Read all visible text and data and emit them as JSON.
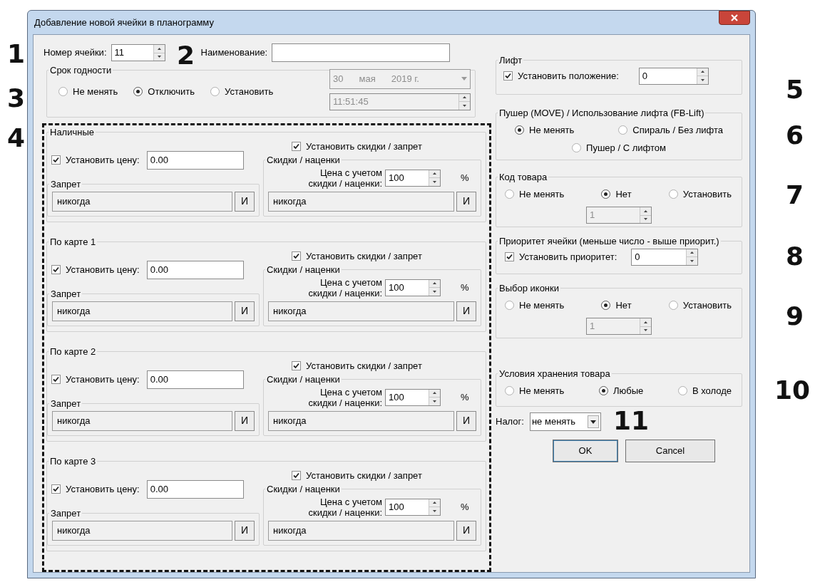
{
  "window": {
    "title": "Добавление новой ячейки в планограмму"
  },
  "cell_number": {
    "label": "Номер ячейки:",
    "value": "11"
  },
  "name_field": {
    "label": "Наименование:"
  },
  "expiry": {
    "title": "Срок годности",
    "options": [
      {
        "label": "Не менять",
        "selected": false
      },
      {
        "label": "Отключить",
        "selected": true
      },
      {
        "label": "Установить",
        "selected": false
      }
    ],
    "date": {
      "day": "30",
      "month": "мая",
      "year": "2019 г.",
      "disabled": true
    },
    "time": {
      "value": "11:51:45",
      "disabled": true
    }
  },
  "price_groups": [
    {
      "title": "Наличные",
      "set_price": {
        "label": "Установить цену:",
        "checked": true,
        "value": "0.00"
      },
      "set_discount": {
        "label": "Установить скидки / запрет",
        "checked": true
      },
      "ban": {
        "title": "Запрет",
        "value": "никогда",
        "button": "И"
      },
      "discounts": {
        "title": "Скидки / наценки",
        "price_label": [
          "Цена с учетом",
          "скидки / наценки:"
        ],
        "value": "100",
        "unit": "%",
        "schedule": "никогда",
        "button": "И"
      }
    },
    {
      "title": "По карте 1",
      "set_price": {
        "label": "Установить цену:",
        "checked": true,
        "value": "0.00"
      },
      "set_discount": {
        "label": "Установить скидки / запрет",
        "checked": true
      },
      "ban": {
        "title": "Запрет",
        "value": "никогда",
        "button": "И"
      },
      "discounts": {
        "title": "Скидки / наценки",
        "price_label": [
          "Цена с учетом",
          "скидки / наценки:"
        ],
        "value": "100",
        "unit": "%",
        "schedule": "никогда",
        "button": "И"
      }
    },
    {
      "title": "По карте 2",
      "set_price": {
        "label": "Установить цену:",
        "checked": true,
        "value": "0.00"
      },
      "set_discount": {
        "label": "Установить скидки / запрет",
        "checked": true
      },
      "ban": {
        "title": "Запрет",
        "value": "никогда",
        "button": "И"
      },
      "discounts": {
        "title": "Скидки / наценки",
        "price_label": [
          "Цена с учетом",
          "скидки / наценки:"
        ],
        "value": "100",
        "unit": "%",
        "schedule": "никогда",
        "button": "И"
      }
    },
    {
      "title": "По карте 3",
      "set_price": {
        "label": "Установить цену:",
        "checked": true,
        "value": "0.00"
      },
      "set_discount": {
        "label": "Установить скидки / запрет",
        "checked": true
      },
      "ban": {
        "title": "Запрет",
        "value": "никогда",
        "button": "И"
      },
      "discounts": {
        "title": "Скидки / наценки",
        "price_label": [
          "Цена с учетом",
          "скидки / наценки:"
        ],
        "value": "100",
        "unit": "%",
        "schedule": "никогда",
        "button": "И"
      }
    }
  ],
  "lift": {
    "title": "Лифт",
    "checkbox": {
      "label": "Установить положение:",
      "checked": true
    },
    "value": "0"
  },
  "pusher": {
    "title": "Пушер (MOVE) / Использование лифта (FB-Lift)",
    "options": [
      {
        "label": "Не менять",
        "selected": true
      },
      {
        "label": "Спираль / Без лифта",
        "selected": false
      },
      {
        "label": "Пушер / С лифтом",
        "selected": false
      }
    ]
  },
  "product_code": {
    "title": "Код товара",
    "options": [
      {
        "label": "Не менять",
        "selected": false
      },
      {
        "label": "Нет",
        "selected": true
      },
      {
        "label": "Установить",
        "selected": false
      }
    ],
    "value": "1",
    "disabled": true
  },
  "priority": {
    "title": "Приоритет ячейки (меньше число - выше приорит.)",
    "checkbox": {
      "label": "Установить приоритет:",
      "checked": true
    },
    "value": "0"
  },
  "icon_choice": {
    "title": "Выбор иконки",
    "options": [
      {
        "label": "Не менять",
        "selected": false
      },
      {
        "label": "Нет",
        "selected": true
      },
      {
        "label": "Установить",
        "selected": false
      }
    ],
    "value": "1",
    "disabled": true
  },
  "storage": {
    "title": "Условия хранения товара",
    "options": [
      {
        "label": "Не менять",
        "selected": false
      },
      {
        "label": "Любые",
        "selected": true
      },
      {
        "label": "В холоде",
        "selected": false
      }
    ]
  },
  "tax": {
    "label": "Налог:",
    "value": "не менять"
  },
  "buttons": [
    "OK",
    "Cancel"
  ],
  "annotations": [
    "1",
    "2",
    "3",
    "4",
    "5",
    "6",
    "7",
    "8",
    "9",
    "10",
    "11"
  ]
}
